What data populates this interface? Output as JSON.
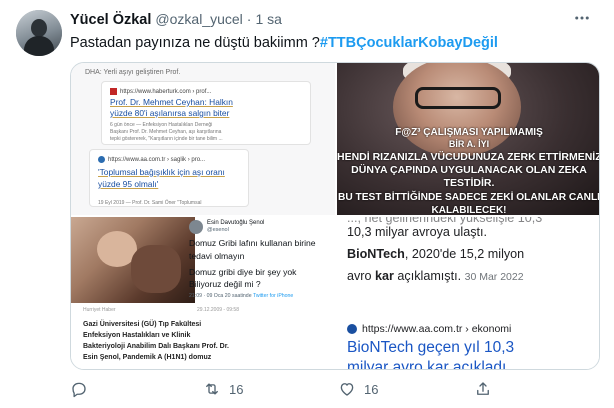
{
  "tweet": {
    "display_name": "Yücel Özkal",
    "handle": "@ozkal_yucel",
    "separator": "·",
    "time": "1 sa",
    "text_prefix": "Pastadan payınıza ne düştü bakiimm  ?",
    "hashtag": "#TTBÇocuklarKobayDeğil"
  },
  "media": {
    "tile1": {
      "note": "DHA: Yerli aşıyı geliştiren Prof.",
      "card1_url": "https://www.haberturk.com › prof...",
      "card1_title_line1": "Prof. Dr. Mehmet Ceyhan: Halkın",
      "card1_title_line2": "yüzde 80'i aşılanırsa salgın biter",
      "card1_snip1": "6 gün önce — Enfeksiyon Hastalıkları Derneği",
      "card1_snip2": "Başkanı Prof. Dr. Mehmet Ceyhan, aşı karşıtlarına",
      "card1_snip3": "tepki göstererek, \"Karşıtların içinde bir tane bilim ...",
      "card2_url": "https://www.aa.com.tr › saglik › pro...",
      "card2_title_line1": "'Toplumsal bağışıklık için aşı oranı",
      "card2_title_line2": "yüzde 95 olmalı'",
      "card2_foot": "19 Eyl 2019 — Prof. Dr. Sami Öner \"Toplumsal"
    },
    "tile2": {
      "line1": "F@Z³ ÇALIŞMASI YAPILMAMIŞ",
      "line2": "BİR A. İYI",
      "line3": "HENDİ RIZANIZLA VÜCUDUNUZA ZERK ETTİRMENİZ,",
      "line4": "DÜNYA ÇAPINDA UYGULANACAK OLAN ZEKA",
      "line5": "TESTİDİR.",
      "line6": "BU TEST BİTTİĞİNDE SADECE ZEKİ OLANLAR CANLI",
      "line7": "KALABILECEK!"
    },
    "tile3": {
      "tw_name": "Esin Davutoğlu Şenol",
      "tw_handle": "@esenol",
      "tw_line1": "Domuz Gribi lafını kullanan birine",
      "tw_line2": "tedavi olmayın",
      "tw_line3": "Domuz gribi diye bir şey yok",
      "tw_line4": "Biliyoruz değil mi ?",
      "tw_meta_prefix": "21:09 · 09 Oca 20 saatinde",
      "tw_meta_link": "Twitter for iPhone",
      "clip_label": "Hurriyet Haber",
      "clip_date": "29.12.2009 - 09:58",
      "clip_line1": "Gazi Üniversitesi (GÜ) Tıp Fakültesi",
      "clip_line2": "Enfeksiyon Hastalıkları ve Klinik",
      "clip_line3": "Bakteriyoloji Anabilim Dalı Başkanı Prof. Dr.",
      "clip_line4": "Esin Şenol, Pandemik A (H1N1) domuz"
    },
    "tile4": {
      "line0": "..., net gelirlerindeki yükselişle 10,3",
      "line1": "10,3 milyar avroya ulaştı.",
      "line2_bold": "BioNTech",
      "line2_rest": ", 2020'de 15,2 milyon",
      "line3_pre": "avro ",
      "line3_bold": "kar",
      "line3_post": " açıklamıştı.",
      "date": "30 Mar 2022",
      "source": "https://www.aa.com.tr › ekonomi",
      "link_line1": "BioNTech geçen yıl 10,3",
      "link_line2": "milyar avro kar açıkladı"
    }
  },
  "actions": {
    "reply_count": "",
    "retweet_count": "16",
    "like_count": "16"
  },
  "colors": {
    "accent": "#1d9bf0",
    "secondary_text": "#536471",
    "link": "#1a56c4"
  }
}
